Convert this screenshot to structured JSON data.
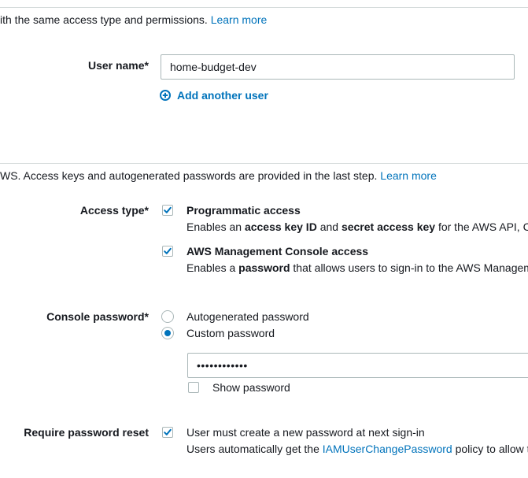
{
  "details": {
    "intro_text": "ith the same access type and permissions.",
    "intro_link": "Learn more",
    "user_name_label": "User name*",
    "user_name_value": "home-budget-dev",
    "add_user_label": "Add another user"
  },
  "access": {
    "intro_text": "WS. Access keys and autogenerated passwords are provided in the last step.",
    "intro_link": "Learn more",
    "access_type_label": "Access type*",
    "programmatic": {
      "title": "Programmatic access",
      "desc_1": "Enables an ",
      "desc_b1": "access key ID",
      "desc_2": " and ",
      "desc_b2": "secret access key",
      "desc_3": " for the AWS API, C",
      "checked": true
    },
    "console": {
      "title": "AWS Management Console access",
      "desc_1": "Enables a ",
      "desc_b1": "password",
      "desc_2": " that allows users to sign-in to the AWS Managem",
      "checked": true
    },
    "console_password_label": "Console password*",
    "autogenerated_label": "Autogenerated password",
    "custom_label": "Custom password",
    "password_value": "••••••••••••",
    "show_password_label": "Show password",
    "require_reset_label": "Require password reset",
    "require_reset_text": "User must create a new password at next sign-in",
    "reset_note_1": "Users automatically get the ",
    "reset_note_link": "IAMUserChangePassword",
    "reset_note_2": " policy to allow t"
  },
  "colors": {
    "link": "#0073bb",
    "text": "#16191f",
    "border": "#aab7b8"
  }
}
